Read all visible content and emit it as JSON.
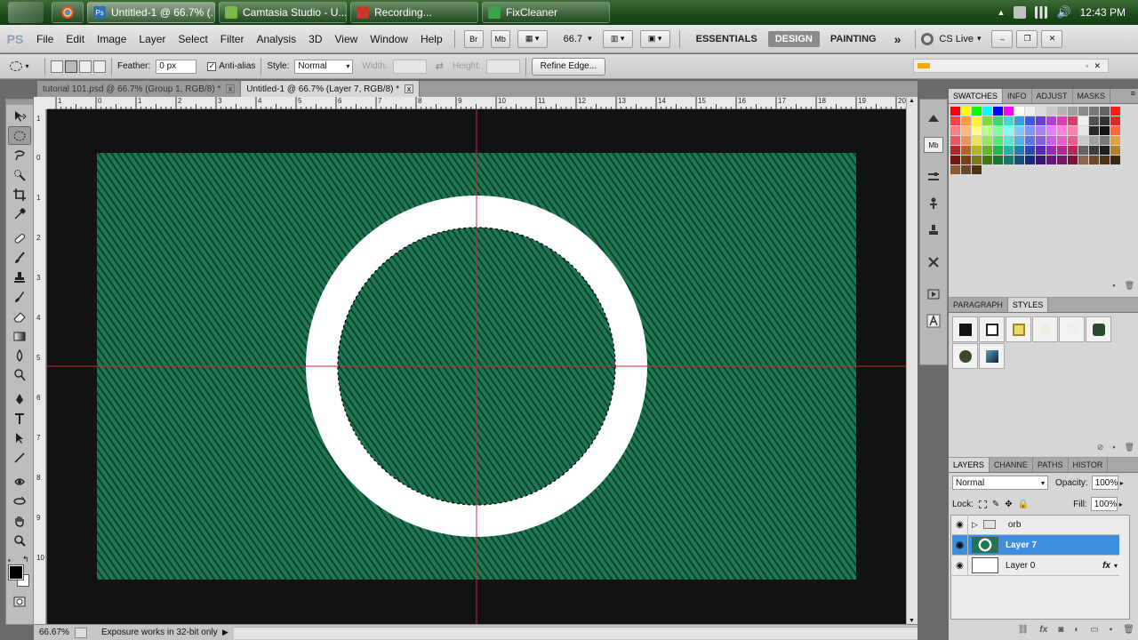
{
  "taskbar": {
    "items": [
      {
        "label": "",
        "icon": "chrome-icon",
        "color": "#e8453c"
      },
      {
        "label": "Untitled-1 @ 66.7% (...",
        "icon": "photoshop-icon",
        "color": "#2f6fb0",
        "active": true
      },
      {
        "label": "Camtasia Studio - U...",
        "icon": "camtasia-icon",
        "color": "#78b84a"
      },
      {
        "label": "Recording...",
        "icon": "record-icon",
        "color": "#c0392b"
      },
      {
        "label": "FixCleaner",
        "icon": "fixcleaner-icon",
        "color": "#3aa34a"
      }
    ],
    "clock": "12:43 PM"
  },
  "menubar": {
    "logo": "PS",
    "menus": [
      "File",
      "Edit",
      "Image",
      "Layer",
      "Select",
      "Filter",
      "Analysis",
      "3D",
      "View",
      "Window",
      "Help"
    ],
    "bridge_label": "Br",
    "minibridge_label": "Mb",
    "zoom_value": "66.7",
    "workspaces": [
      "ESSENTIALS",
      "DESIGN",
      "PAINTING"
    ],
    "more_label": "»",
    "cslive_label": "CS Live"
  },
  "options": {
    "feather_label": "Feather:",
    "feather_value": "0 px",
    "antialias_label": "Anti-alias",
    "style_label": "Style:",
    "style_value": "Normal",
    "width_label": "Width:",
    "height_label": "Height:",
    "refine_label": "Refine Edge..."
  },
  "tabs": [
    {
      "label": "tutorial 101.psd @ 66.7% (Group 1, RGB/8) *",
      "close": "x"
    },
    {
      "label": "Untitled-1 @ 66.7% (Layer 7, RGB/8) *",
      "close": "x",
      "active": true
    }
  ],
  "ruler": {
    "top": [
      "1",
      "0",
      "1",
      "2",
      "3",
      "4",
      "5",
      "6",
      "7",
      "8",
      "9",
      "10",
      "11",
      "12",
      "13",
      "14",
      "15",
      "16",
      "17",
      "18",
      "19",
      "20"
    ],
    "left": [
      "1",
      "0",
      "1",
      "2",
      "3",
      "4",
      "5",
      "6",
      "7",
      "8",
      "9",
      "10"
    ]
  },
  "canvas": {
    "background": "#121212",
    "fill_color": "#1b7a52",
    "stripe_color": "#0f3d2a",
    "ring_color": "#ffffff",
    "guide_color": "#c8283c"
  },
  "status": {
    "zoom": "66.67%",
    "info": "Exposure works in 32-bit only"
  },
  "swatches_panel": {
    "tabs": [
      "SWATCHES",
      "INFO",
      "ADJUST",
      "MASKS"
    ],
    "colors": [
      "#ff0000",
      "#ffff00",
      "#00ff00",
      "#00ffff",
      "#0000ff",
      "#ff00ff",
      "#ffffff",
      "#f0f0f0",
      "#dcdcdc",
      "#c8c8c8",
      "#b4b4b4",
      "#a0a0a0",
      "#8c8c8c",
      "#787878",
      "#646464",
      "#ff1a1a",
      "#ff4040",
      "#ff9a3c",
      "#fff23c",
      "#7ddc3c",
      "#3cdc6a",
      "#3cdcc8",
      "#3c9ddc",
      "#3c5adc",
      "#6a3cdc",
      "#b43cdc",
      "#dc3cb4",
      "#dc3c6a",
      "#f0f0f0",
      "#505050",
      "#323232",
      "#dc2828",
      "#ff8080",
      "#ffb980",
      "#ffff80",
      "#b9ff80",
      "#80ff9d",
      "#80fff0",
      "#80c8ff",
      "#8096ff",
      "#a880ff",
      "#e080ff",
      "#ff80e0",
      "#ff80a8",
      "#e6e6e6",
      "#282828",
      "#141414",
      "#ff6a3c",
      "#e65c5c",
      "#e6965c",
      "#e6e65c",
      "#96e65c",
      "#5ce67a",
      "#5ce6d2",
      "#5cace6",
      "#5c74e6",
      "#8a5ce6",
      "#c85ce6",
      "#e65cc8",
      "#e65c8a",
      "#c8c8c8",
      "#a0a0a0",
      "#787878",
      "#e6a03c",
      "#b42828",
      "#b46428",
      "#b4b428",
      "#64b428",
      "#28b44a",
      "#28b4a0",
      "#287ab4",
      "#2846b4",
      "#5a28b4",
      "#9628b4",
      "#b42896",
      "#b4285a",
      "#646464",
      "#3c3c3c",
      "#1e1e1e",
      "#b48228",
      "#7a1414",
      "#7a4014",
      "#7a7a14",
      "#407a14",
      "#147a30",
      "#147a6a",
      "#14507a",
      "#142c7a",
      "#3a147a",
      "#66147a",
      "#7a1466",
      "#7a143a",
      "#8c6446",
      "#6e4628",
      "#503214",
      "#3c2814",
      "#8c5a32",
      "#6e4628",
      "#503214"
    ]
  },
  "paragraph_panel": {
    "tabs": [
      "PARAGRAPH",
      "STYLES"
    ]
  },
  "layers_panel": {
    "tabs": [
      "LAYERS",
      "CHANNE",
      "PATHS",
      "HISTOR"
    ],
    "blend_mode": "Normal",
    "opacity_label": "Opacity:",
    "opacity_value": "100%",
    "lock_label": "Lock:",
    "fill_label": "Fill:",
    "fill_value": "100%",
    "layers": [
      {
        "name": "orb",
        "type": "group"
      },
      {
        "name": "Layer 7",
        "type": "layer",
        "selected": true
      },
      {
        "name": "Layer 0",
        "type": "layer",
        "fx": "fx"
      }
    ]
  }
}
